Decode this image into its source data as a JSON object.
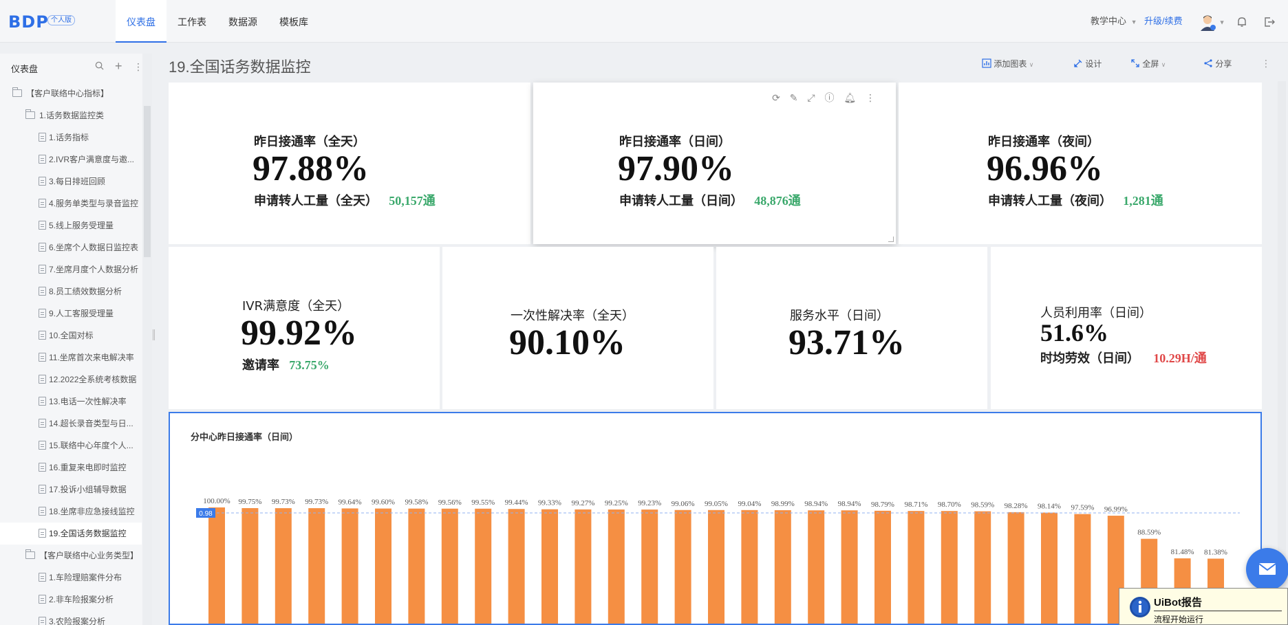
{
  "app": {
    "logo": "BDP",
    "edition": "个人版"
  },
  "nav": {
    "tabs": [
      {
        "label": "仪表盘"
      },
      {
        "label": "工作表"
      },
      {
        "label": "数据源"
      },
      {
        "label": "模板库"
      }
    ],
    "teaching_center": "教学中心",
    "upgrade": "升级/续费"
  },
  "sidebar": {
    "title": "仪表盘",
    "items": [
      {
        "label": "【客户联络中心指标】",
        "type": "folder",
        "level": 0
      },
      {
        "label": "1.话务数据监控类",
        "type": "folder",
        "level": 1
      },
      {
        "label": "1.话务指标",
        "type": "doc",
        "level": 2
      },
      {
        "label": "2.IVR客户满意度与邀...",
        "type": "doc",
        "level": 2
      },
      {
        "label": "3.每日排班回顾",
        "type": "doc",
        "level": 2
      },
      {
        "label": "4.服务单类型与录音监控",
        "type": "doc",
        "level": 2
      },
      {
        "label": "5.线上服务受理量",
        "type": "doc",
        "level": 2
      },
      {
        "label": "6.坐席个人数据日监控表",
        "type": "doc",
        "level": 2
      },
      {
        "label": "7.坐席月度个人数据分析",
        "type": "doc",
        "level": 2
      },
      {
        "label": "8.员工绩效数据分析",
        "type": "doc",
        "level": 2
      },
      {
        "label": "9.人工客服受理量",
        "type": "doc",
        "level": 2
      },
      {
        "label": "10.全国对标",
        "type": "doc",
        "level": 2
      },
      {
        "label": "11.坐席首次来电解决率",
        "type": "doc",
        "level": 2
      },
      {
        "label": "12.2022全系统考核数据",
        "type": "doc",
        "level": 2
      },
      {
        "label": "13.电话一次性解决率",
        "type": "doc",
        "level": 2
      },
      {
        "label": "14.超长录音类型与日...",
        "type": "doc",
        "level": 2
      },
      {
        "label": "15.联络中心年度个人...",
        "type": "doc",
        "level": 2
      },
      {
        "label": "16.重复来电即时监控",
        "type": "doc",
        "level": 2
      },
      {
        "label": "17.投诉小组辅导数据",
        "type": "doc",
        "level": 2
      },
      {
        "label": "18.坐席非应急接线监控",
        "type": "doc",
        "level": 2
      },
      {
        "label": "19.全国话务数据监控",
        "type": "doc",
        "level": 2,
        "active": true
      },
      {
        "label": "【客户联络中心业务类型】",
        "type": "folder",
        "level": 1
      },
      {
        "label": "1.车险理赔案件分布",
        "type": "doc",
        "level": 2
      },
      {
        "label": "2.非车险报案分析",
        "type": "doc",
        "level": 2
      },
      {
        "label": "3.农险报案分析",
        "type": "doc",
        "level": 2
      }
    ]
  },
  "page": {
    "title": "19.全国话务数据监控",
    "actions": {
      "add_chart": "添加图表",
      "design": "设计",
      "fullscreen": "全屏",
      "share": "分享"
    }
  },
  "kpis_top": [
    {
      "label": "昨日接通率（全天）",
      "value": "97.88%",
      "sub_label": "申请转人工量（全天）",
      "sub_value": "50,157通"
    },
    {
      "label": "昨日接通率（日间）",
      "value": "97.90%",
      "sub_label": "申请转人工量（日间）",
      "sub_value": "48,876通"
    },
    {
      "label": "昨日接通率（夜间）",
      "value": "96.96%",
      "sub_label": "申请转人工量（夜间）",
      "sub_value": "1,281通"
    }
  ],
  "kpis_mid": [
    {
      "label": "IVR满意度（全天）",
      "value": "99.92%",
      "sub_label": "邀请率",
      "sub_value": "73.75%"
    },
    {
      "label": "一次性解决率（全天）",
      "value": "90.10%"
    },
    {
      "label": "服务水平（日间）",
      "value": "93.71%"
    },
    {
      "label": "人员利用率（日间）",
      "value": "51.6%",
      "sub_label": "时均劳效（日间）",
      "sub_value": "10.29H/通"
    }
  ],
  "chart_data": {
    "type": "bar",
    "title": "分中心昨日接通率（日间）",
    "reference_line": {
      "label": "0.98",
      "value": 98.0
    },
    "values": [
      100.0,
      99.75,
      99.73,
      99.73,
      99.64,
      99.6,
      99.58,
      99.56,
      99.55,
      99.44,
      99.33,
      99.27,
      99.25,
      99.23,
      99.06,
      99.05,
      99.04,
      98.99,
      98.94,
      98.94,
      98.79,
      98.71,
      98.7,
      98.59,
      98.28,
      98.14,
      97.59,
      96.99,
      88.59,
      81.48,
      81.38
    ],
    "data_labels": [
      "100.00%",
      "99.75%",
      "99.73%",
      "99.73%",
      "99.64%",
      "99.60%",
      "99.58%",
      "99.56%",
      "99.55%",
      "99.44%",
      "99.33%",
      "99.27%",
      "99.25%",
      "99.23%",
      "99.06%",
      "99.05%",
      "99.04%",
      "98.99%",
      "98.94%",
      "98.94%",
      "98.79%",
      "98.71%",
      "98.70%",
      "98.59%",
      "98.28%",
      "98.14%",
      "97.59%",
      "96.99%",
      "88.59%",
      "81.48%",
      "81.38%"
    ],
    "bar_color": "#f58f43"
  },
  "uibot": {
    "title": "UiBot报告",
    "message": "流程开始运行"
  },
  "colors": {
    "accent": "#2e6fe6",
    "positive": "#3aa86b",
    "negative": "#e04848"
  }
}
